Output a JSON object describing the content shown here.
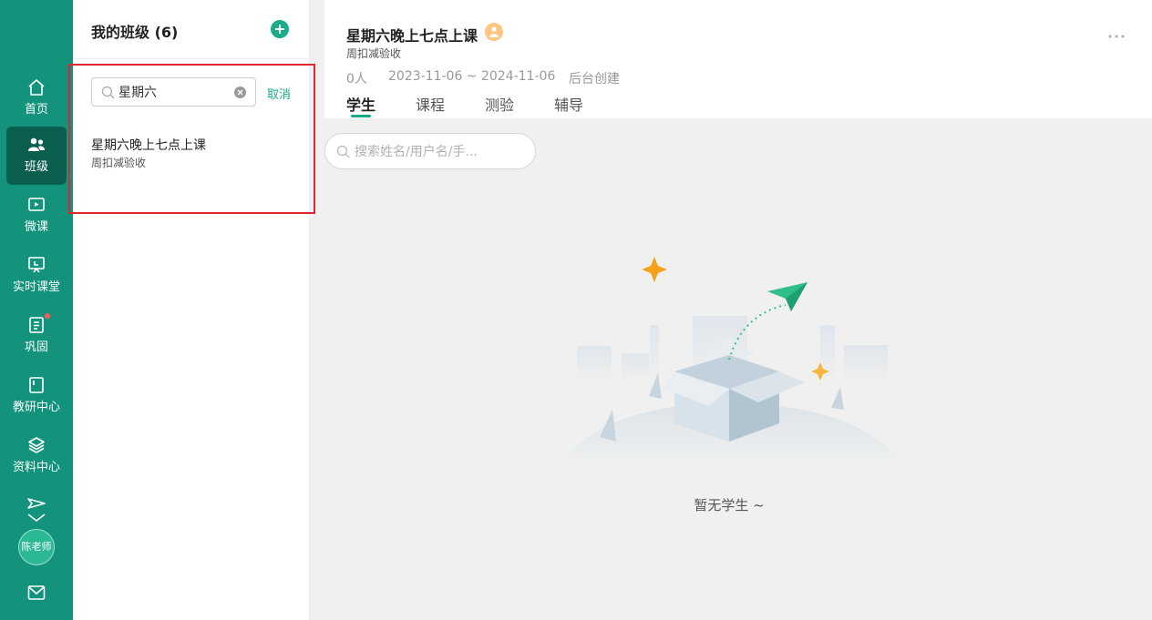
{
  "nav": {
    "items": [
      {
        "label": "首页",
        "icon": "home-icon"
      },
      {
        "label": "班级",
        "icon": "people-icon"
      },
      {
        "label": "微课",
        "icon": "video-icon"
      },
      {
        "label": "实时课堂",
        "icon": "presentation-icon"
      },
      {
        "label": "巩固",
        "icon": "notebook-icon"
      },
      {
        "label": "教研中心",
        "icon": "book-icon"
      },
      {
        "label": "资料中心",
        "icon": "layers-icon"
      }
    ],
    "active": "班级",
    "user": "陈老师"
  },
  "class_panel": {
    "title": "我的班级 (6)",
    "search": {
      "value": "星期六"
    },
    "cancel_label": "取消",
    "results": [
      {
        "name": "星期六晚上七点上课",
        "subtitle": "周扣减验收"
      }
    ]
  },
  "class_detail": {
    "title": "星期六晚上七点上课",
    "subtitle": "周扣减验收",
    "meta": {
      "count": "0人",
      "date_range": "2023-11-06 ~ 2024-11-06",
      "source": "后台创建"
    },
    "tabs": [
      {
        "label": "学生"
      },
      {
        "label": "课程"
      },
      {
        "label": "测验"
      },
      {
        "label": "辅导"
      }
    ],
    "active_tab": "学生",
    "student_search": {
      "placeholder": "搜索姓名/用户名/手..."
    },
    "empty_text": "暂无学生 ~"
  },
  "colors": {
    "brand": "#13937b",
    "accent": "#1aab8a",
    "highlight": "#e0262e"
  }
}
